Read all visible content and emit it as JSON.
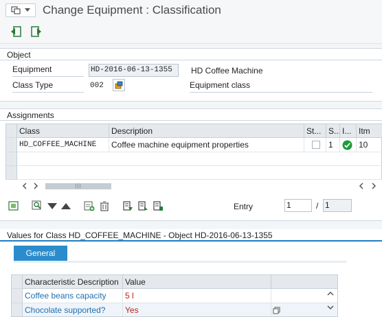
{
  "window": {
    "title": "Change Equipment : Classification"
  },
  "object": {
    "section_title": "Object",
    "equipment_label": "Equipment",
    "equipment_value": "HD-2016-06-13-1355",
    "equipment_desc": "HD Coffee Machine",
    "class_type_label": "Class Type",
    "class_type_value": "002",
    "class_type_desc": "Equipment class"
  },
  "assignments": {
    "section_title": "Assignments",
    "columns": [
      "Class",
      "Description",
      "St...",
      "S...",
      "I...",
      "Itm"
    ],
    "rows": [
      {
        "class": "HD_COFFEE_MACHINE",
        "description": "Coffee machine equipment properties",
        "status_checked": false,
        "s": "1",
        "i": "check",
        "itm": "10"
      }
    ],
    "entry_label": "Entry",
    "entry_value": "1",
    "entry_separator": "/",
    "entry_total": "1"
  },
  "values": {
    "section_title": "Values for Class HD_COFFEE_MACHINE - Object HD-2016-06-13-1355",
    "tab_label": "General",
    "columns": [
      "Characteristic Description",
      "Value"
    ],
    "rows": [
      {
        "desc": "Coffee beans capacity",
        "value": "5 l"
      },
      {
        "desc": "Chocolate supported?",
        "value": "Yes"
      }
    ]
  },
  "colors": {
    "accent": "#2a8ccc",
    "link": "#1f6fb2",
    "value": "#b8241c",
    "check": "#1d9b3a"
  }
}
